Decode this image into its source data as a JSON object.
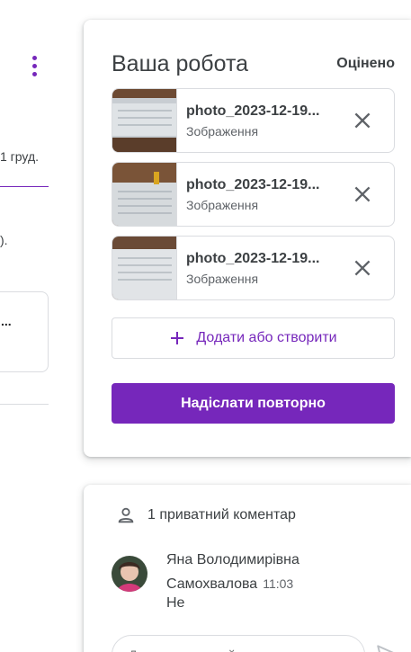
{
  "left_panel": {
    "date_fragment": "1 груд.",
    "paren_fragment": ").",
    "card_fragment": "..."
  },
  "work": {
    "title": "Ваша робота",
    "status": "Оцінено",
    "files": [
      {
        "name": "photo_2023-12-19...",
        "type": "Зображення"
      },
      {
        "name": "photo_2023-12-19...",
        "type": "Зображення"
      },
      {
        "name": "photo_2023-12-19...",
        "type": "Зображення"
      }
    ],
    "add_label": "Додати або створити",
    "resend_label": "Надіслати повторно"
  },
  "comments": {
    "header": "1 приватний коментар",
    "author": "Яна Володимирівна Самохвалова",
    "time": "11:03",
    "text": "Не",
    "input_placeholder": "Додати приватний коментар..."
  },
  "colors": {
    "accent": "#7627bb",
    "border": "#dadce0",
    "text": "#3c4043",
    "secondary_text": "#5f6368"
  },
  "icons": [
    "more-vert-icon",
    "close-icon",
    "plus-icon",
    "person-icon",
    "send-icon"
  ]
}
